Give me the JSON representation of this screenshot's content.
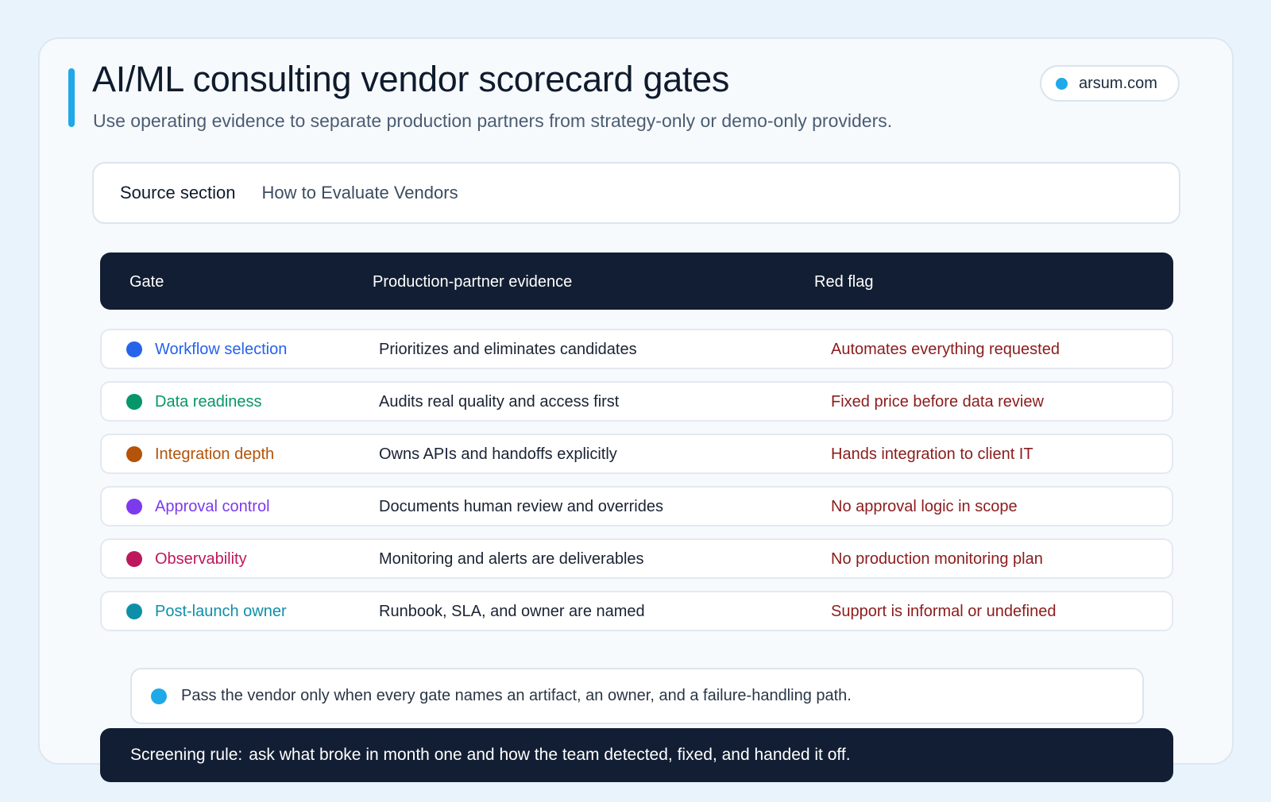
{
  "header": {
    "title": "AI/ML consulting vendor scorecard gates",
    "subtitle": "Use operating evidence to separate production partners from strategy-only or demo-only providers.",
    "domain": "arsum.com"
  },
  "source": {
    "label": "Source section",
    "value": "How to Evaluate Vendors"
  },
  "table": {
    "columns": [
      "Gate",
      "Production-partner evidence",
      "Red flag"
    ],
    "rows": [
      {
        "gate": "Workflow selection",
        "color": "#2563eb",
        "evidence": "Prioritizes and eliminates candidates",
        "red_flag": "Automates everything requested"
      },
      {
        "gate": "Data readiness",
        "color": "#059669",
        "evidence": "Audits real quality and access first",
        "red_flag": "Fixed price before data review"
      },
      {
        "gate": "Integration depth",
        "color": "#b45309",
        "evidence": "Owns APIs and handoffs explicitly",
        "red_flag": "Hands integration to client IT"
      },
      {
        "gate": "Approval control",
        "color": "#7c3aed",
        "evidence": "Documents human review and overrides",
        "red_flag": "No approval logic in scope"
      },
      {
        "gate": "Observability",
        "color": "#be185d",
        "evidence": "Monitoring and alerts are deliverables",
        "red_flag": "No production monitoring plan"
      },
      {
        "gate": "Post-launch owner",
        "color": "#0e8fa8",
        "evidence": "Runbook, SLA, and owner are named",
        "red_flag": "Support is informal or undefined"
      }
    ]
  },
  "note": "Pass the vendor only when every gate names an artifact, an owner, and a failure-handling path.",
  "rule": {
    "label": "Screening rule:",
    "text": "ask what broke in month one and how the team detected, fixed, and handed it off."
  }
}
